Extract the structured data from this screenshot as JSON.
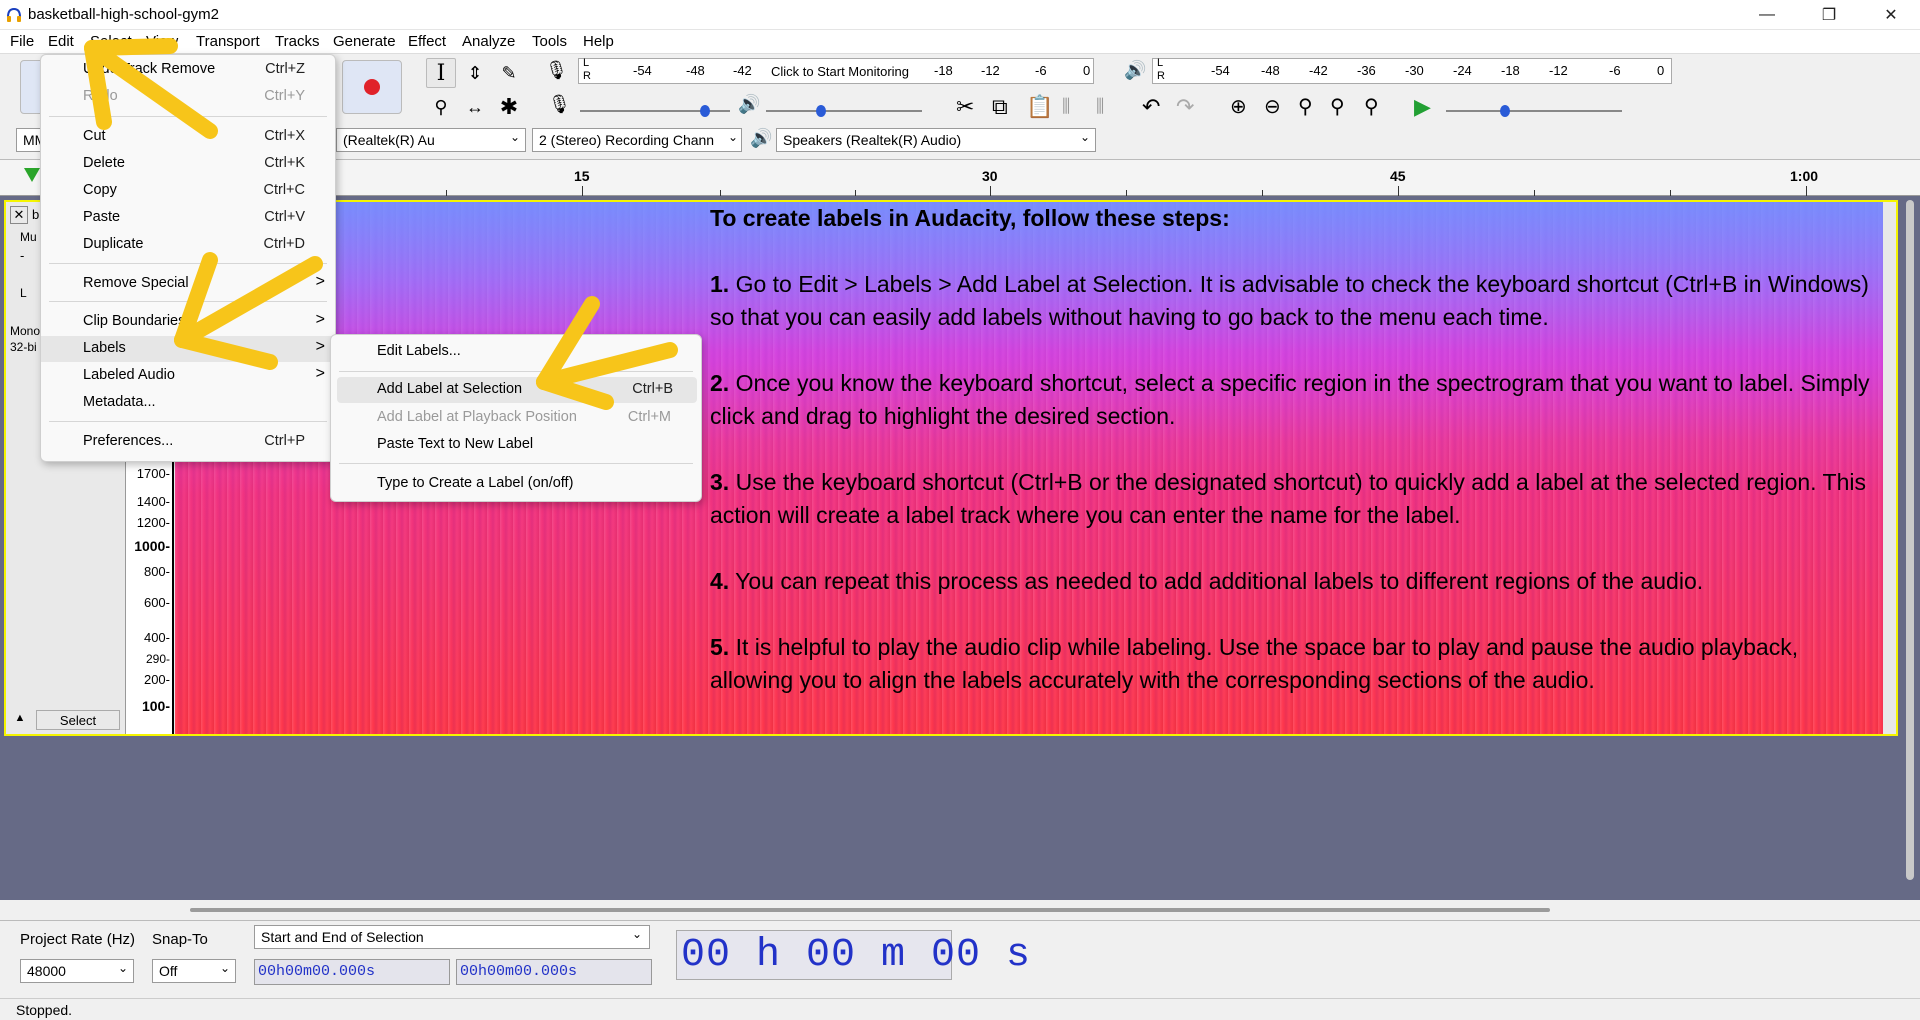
{
  "window": {
    "title": "basketball-high-school-gym2",
    "minimize": "—",
    "maximize": "❐",
    "close": "✕"
  },
  "menubar": [
    "File",
    "Edit",
    "Select",
    "View",
    "Transport",
    "Tracks",
    "Generate",
    "Effect",
    "Analyze",
    "Tools",
    "Help"
  ],
  "meters": {
    "record_ticks": [
      "-54",
      "-48",
      "-42",
      "Click to Start Monitoring",
      "-18",
      "-12",
      "-6",
      "0"
    ],
    "playback_ticks": [
      "-54",
      "-48",
      "-42",
      "-36",
      "-30",
      "-24",
      "-18",
      "-12",
      "-6",
      "0"
    ],
    "lr": [
      "L",
      "R"
    ]
  },
  "devices": {
    "host": "MM",
    "recording_device": "(Realtek(R) Au",
    "channels": "2 (Stereo) Recording Chann",
    "playback_device": "Speakers (Realtek(R) Audio)"
  },
  "ruler": {
    "ticks": [
      "15",
      "30",
      "45",
      "1:00"
    ]
  },
  "track": {
    "name": "b",
    "mute": "Mu",
    "minus": "-",
    "pan_l": "L",
    "info_line1": "Mono",
    "info_line2": "32-bi",
    "select_button": "Select",
    "collapse": "▲"
  },
  "vscale": [
    "1700-",
    "1400-",
    "1200-",
    "1000-",
    "800-",
    "600-",
    "400-",
    "290-",
    "200-",
    "100-"
  ],
  "overlay": {
    "heading": "To create labels in Audacity, follow these steps:",
    "steps": [
      {
        "num": "1.",
        "text": " Go to Edit > Labels > Add Label at Selection. It is advisable to check the keyboard shortcut (Ctrl+B in Windows) so that you can easily add labels without having to go back to the menu each time."
      },
      {
        "num": "2.",
        "text": " Once you know the keyboard shortcut, select a specific region in the spectrogram that you want to label. Simply click and drag to highlight the desired section."
      },
      {
        "num": "3.",
        "text": " Use the keyboard shortcut (Ctrl+B or the designated shortcut) to quickly add a label at the selected region. This action will create a label track where you can enter the name for the label."
      },
      {
        "num": "4.",
        "text": " You can repeat this process as needed to add additional labels to different regions of the audio."
      },
      {
        "num": "5.",
        "text": " It is helpful to play the audio clip while labeling. Use the space bar to play and pause the audio playback, allowing you to align the labels accurately with the corresponding sections of the audio."
      }
    ]
  },
  "edit_menu": {
    "items": [
      {
        "label": "Undo Track Remove",
        "shortcut": "Ctrl+Z",
        "disabled": false
      },
      {
        "label": "Redo",
        "shortcut": "Ctrl+Y",
        "disabled": true
      },
      {
        "label": "Cut",
        "shortcut": "Ctrl+X",
        "disabled": false
      },
      {
        "label": "Delete",
        "shortcut": "Ctrl+K",
        "disabled": false
      },
      {
        "label": "Copy",
        "shortcut": "Ctrl+C",
        "disabled": false
      },
      {
        "label": "Paste",
        "shortcut": "Ctrl+V",
        "disabled": false
      },
      {
        "label": "Duplicate",
        "shortcut": "Ctrl+D",
        "disabled": false
      },
      {
        "label": "Remove Special",
        "shortcut": "",
        "disabled": false
      },
      {
        "label": "Clip Boundaries",
        "shortcut": "",
        "disabled": false
      },
      {
        "label": "Labels",
        "shortcut": "",
        "disabled": false
      },
      {
        "label": "Labeled Audio",
        "shortcut": "",
        "disabled": false
      },
      {
        "label": "Metadata...",
        "shortcut": "",
        "disabled": false
      },
      {
        "label": "Preferences...",
        "shortcut": "Ctrl+P",
        "disabled": false
      }
    ],
    "submenu_arrow": ">"
  },
  "labels_submenu": {
    "items": [
      {
        "label": "Edit Labels...",
        "shortcut": "",
        "disabled": false
      },
      {
        "label": "Add Label at Selection",
        "shortcut": "Ctrl+B",
        "disabled": false
      },
      {
        "label": "Add Label at Playback Position",
        "shortcut": "Ctrl+M",
        "disabled": true
      },
      {
        "label": "Paste Text to New Label",
        "shortcut": "",
        "disabled": false
      },
      {
        "label": "Type to Create a Label (on/off)",
        "shortcut": "",
        "disabled": false
      }
    ]
  },
  "bottom": {
    "project_rate_label": "Project Rate (Hz)",
    "project_rate_value": "48000",
    "snap_to_label": "Snap-To",
    "snap_to_value": "Off",
    "selection_mode": "Start and End of Selection",
    "sel_start": "00h00m00.000s",
    "sel_end": "00h00m00.000s",
    "time_display": "00 h 00 m 00 s"
  },
  "status": {
    "text": "Stopped."
  },
  "colors": {
    "arrow": "#f7c51a",
    "selection_border": "#f5f500",
    "time_digits": "#2232c8"
  }
}
